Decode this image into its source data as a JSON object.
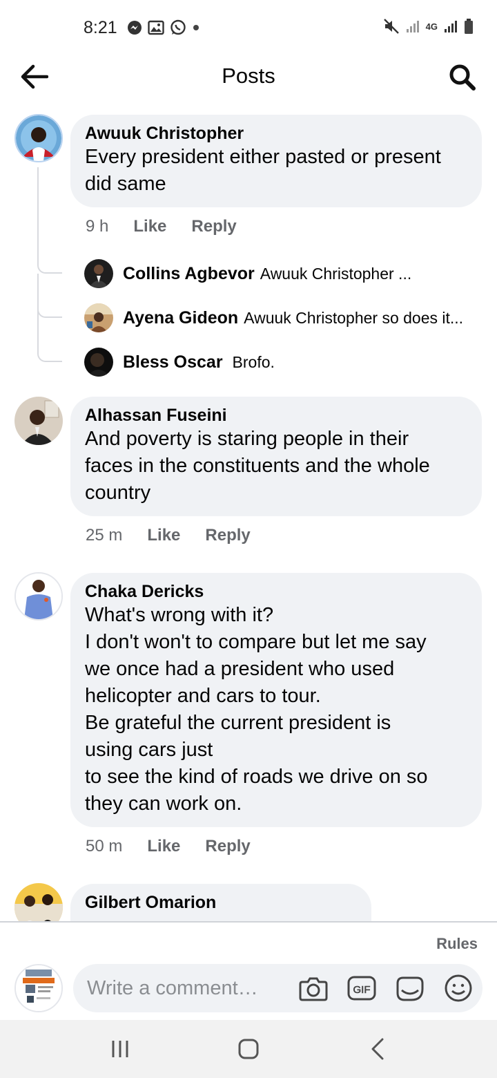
{
  "status_bar": {
    "time": "8:21",
    "left_icons": [
      "messenger-icon",
      "gallery-icon",
      "whatsapp-icon",
      "notification-dot-icon"
    ],
    "right_icons": [
      "mute-icon",
      "signal-icon",
      "4g-icon",
      "signal-icon",
      "battery-icon"
    ],
    "network_label": "4G"
  },
  "header": {
    "title": "Posts",
    "back_icon": "arrow-left-icon",
    "search_icon": "search-icon"
  },
  "comments": [
    {
      "author": "Awuuk Christopher",
      "text_lines": [
        "Every president either pasted or present",
        "did same"
      ],
      "time": "9 h",
      "like_label": "Like",
      "reply_label": "Reply",
      "replies": [
        {
          "author": "Collins Agbevor",
          "text": "Awuuk Christopher ..."
        },
        {
          "author": "Ayena Gideon",
          "text": "Awuuk Christopher so does it..."
        },
        {
          "author": "Bless Oscar",
          "text": "Brofo."
        }
      ]
    },
    {
      "author": "Alhassan Fuseini",
      "text_lines": [
        "And poverty is staring people in their",
        "faces in the constituents and the whole",
        "country"
      ],
      "time": "25 m",
      "like_label": "Like",
      "reply_label": "Reply"
    },
    {
      "author": "Chaka Dericks",
      "text_lines": [
        "What's wrong with it?",
        "I don't won't to compare but let me say",
        "we once had a president who used",
        "helicopter and cars to tour.",
        "Be grateful the current president is",
        "using cars just",
        "to see the kind of roads we drive on so",
        "they can work on."
      ],
      "time": "50 m",
      "like_label": "Like",
      "reply_label": "Reply"
    },
    {
      "author": "Gilbert Omarion"
    }
  ],
  "composer": {
    "rules_label": "Rules",
    "placeholder": "Write a comment…",
    "icons": [
      "camera-icon",
      "gif-icon",
      "sticker-icon",
      "emoji-icon"
    ],
    "gif_label": "GIF"
  },
  "nav_bar": {
    "icons": [
      "recent-apps-icon",
      "home-icon",
      "back-icon"
    ]
  },
  "colors": {
    "bubble": "#f0f2f5",
    "meta_text": "#65676b",
    "primary_text": "#050505"
  }
}
